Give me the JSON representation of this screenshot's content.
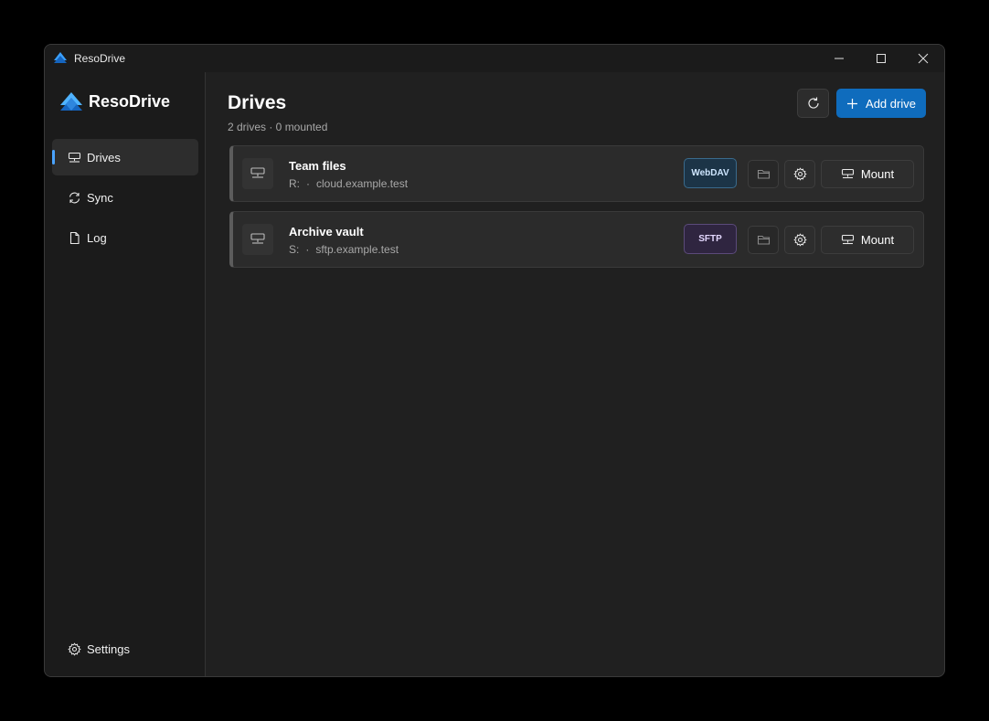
{
  "window": {
    "title": "ResoDrive"
  },
  "sidebar": {
    "brand": "ResoDrive",
    "items": [
      {
        "label": "Drives",
        "icon": "drive-icon",
        "active": true
      },
      {
        "label": "Sync",
        "icon": "sync-icon"
      },
      {
        "label": "Log",
        "icon": "document-icon"
      }
    ],
    "settings_label": "Settings"
  },
  "main": {
    "title": "Drives",
    "subtitle": "2 drives · 0 mounted",
    "add_label": "Add drive",
    "drives": [
      {
        "name": "Team files",
        "letter": "R:",
        "host": "cloud.example.test",
        "type": "WebDAV",
        "action": "Mount"
      },
      {
        "name": "Archive vault",
        "letter": "S:",
        "host": "sftp.example.test",
        "type": "SFTP",
        "action": "Mount"
      }
    ]
  },
  "colors": {
    "accent": "#0f6cbd",
    "nav_indicator": "#4aa3ff",
    "background": "#202020",
    "sidebar": "#1b1b1b"
  }
}
